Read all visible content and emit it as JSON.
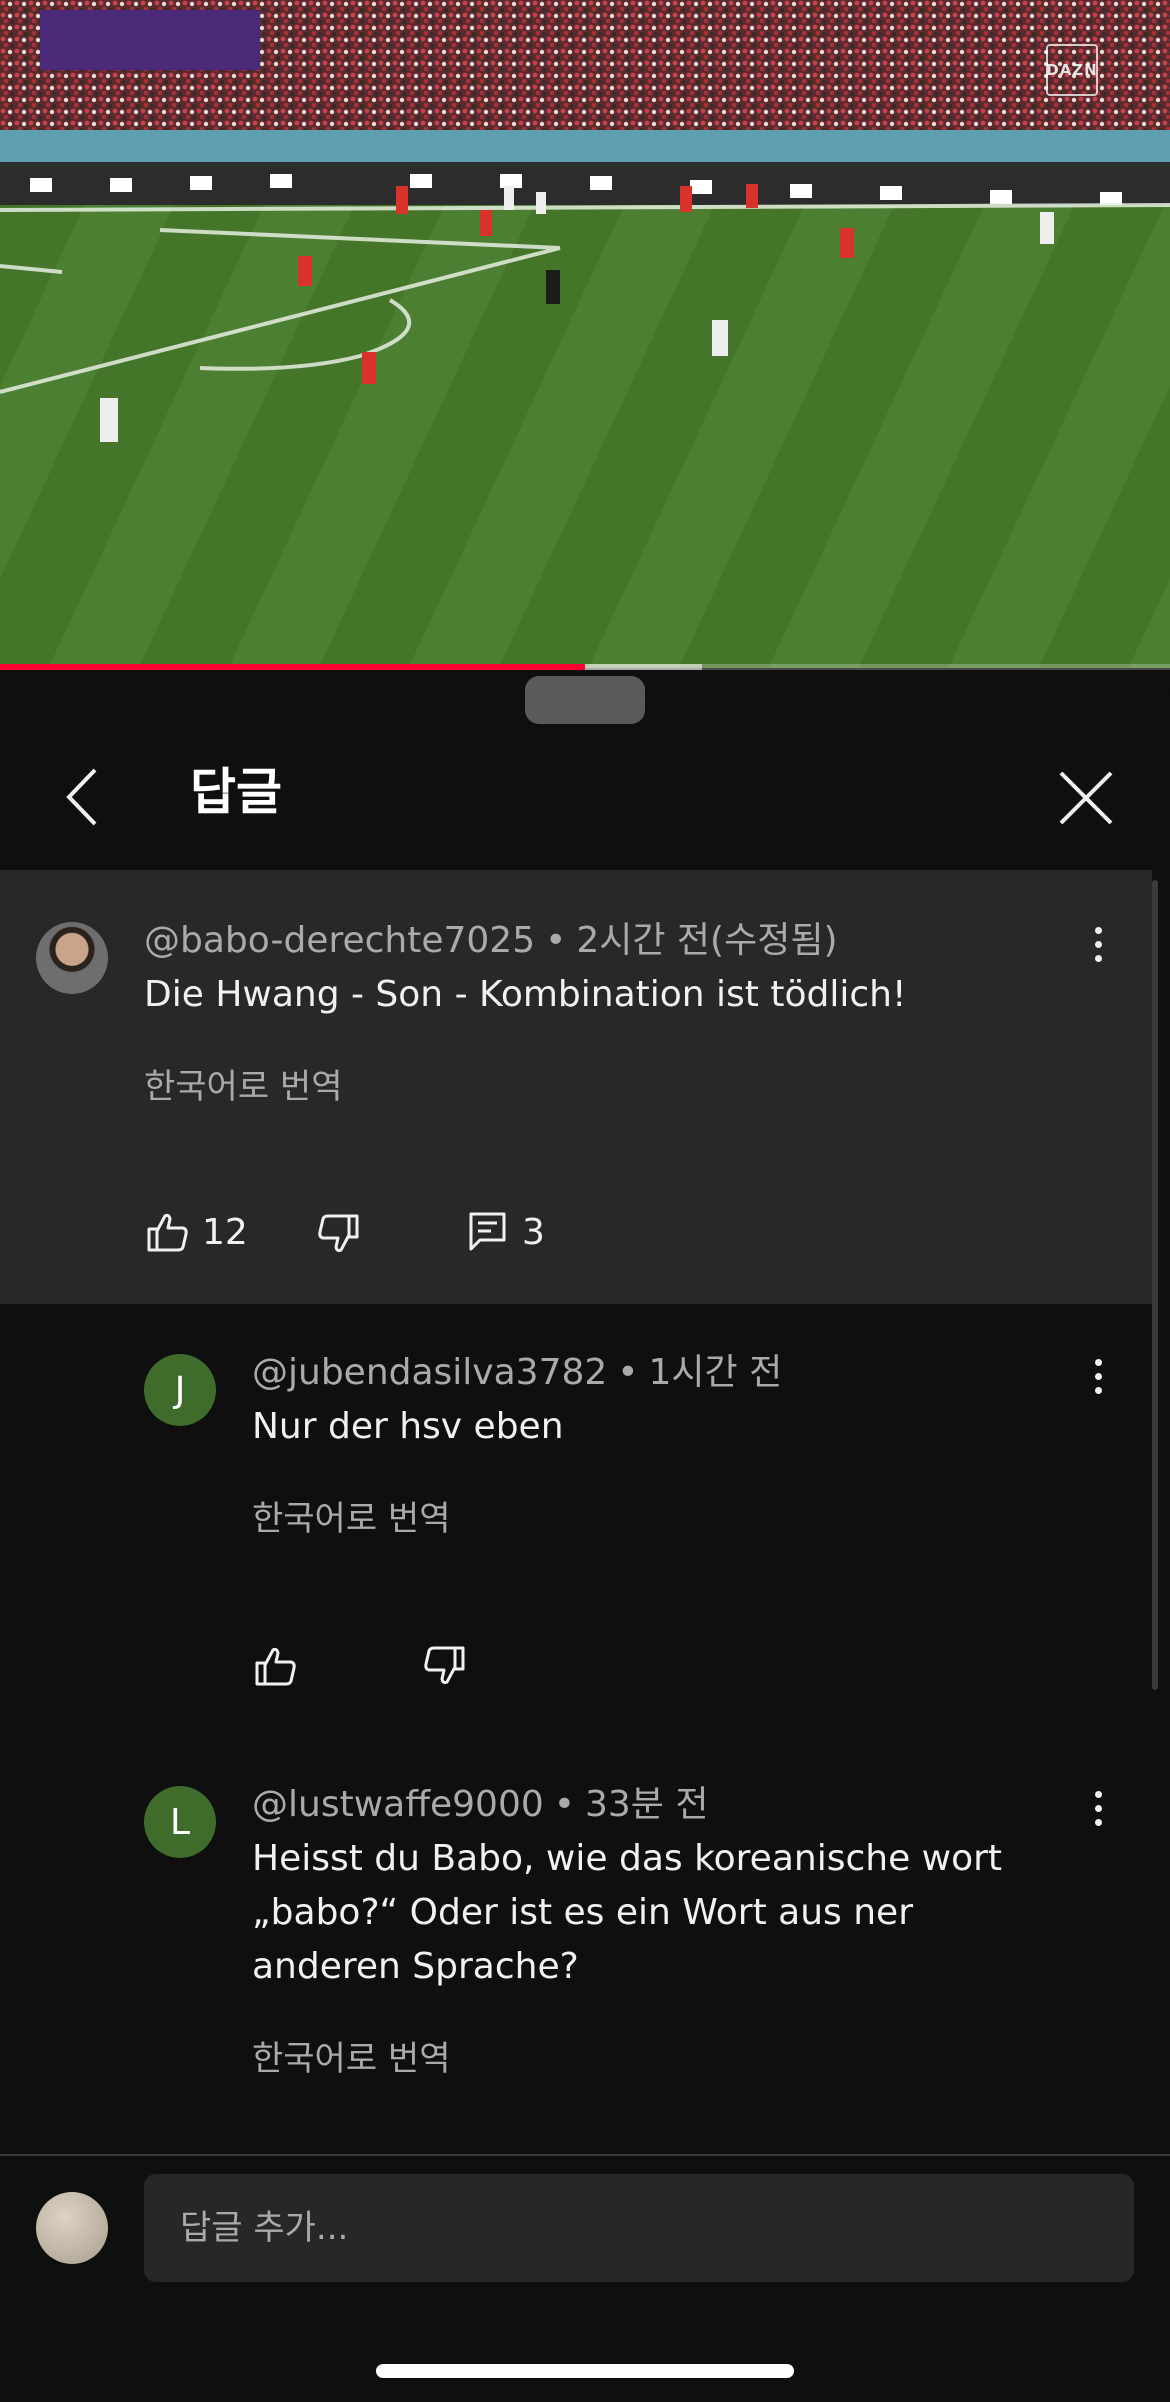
{
  "video": {
    "watermark": "DAZN",
    "progress_fraction": 0.5,
    "buffered_fraction": 0.6,
    "colors": {
      "played": "#ff0033"
    }
  },
  "header": {
    "title": "답글",
    "back_icon": "chevron-left-icon",
    "close_icon": "close-icon"
  },
  "parent_comment": {
    "author": "@babo-derechte7025",
    "separator": "•",
    "time": "2시간 전(수정됨)",
    "text": "Die Hwang - Son - Kombination ist tödlich!",
    "translate": "한국어로 번역",
    "likes": "12",
    "replies_count": "3"
  },
  "replies": [
    {
      "avatar_letter": "J",
      "author": "@jubendasilva3782",
      "separator": "•",
      "time": "1시간 전",
      "text": "Nur der hsv eben",
      "translate": "한국어로 번역"
    },
    {
      "avatar_letter": "L",
      "author": "@lustwaffe9000",
      "separator": "•",
      "time": "33분 전",
      "text": "Heisst du Babo, wie das koreanische wort „babo?“ Oder ist es ein Wort aus ner anderen Sprache?",
      "translate": "한국어로 번역"
    }
  ],
  "composer": {
    "placeholder": "답글 추가..."
  },
  "colors": {
    "background": "#0f0f0f",
    "highlight": "#282828",
    "avatar_green": "#3f6c2a",
    "secondary_text": "#aaaaaa"
  }
}
